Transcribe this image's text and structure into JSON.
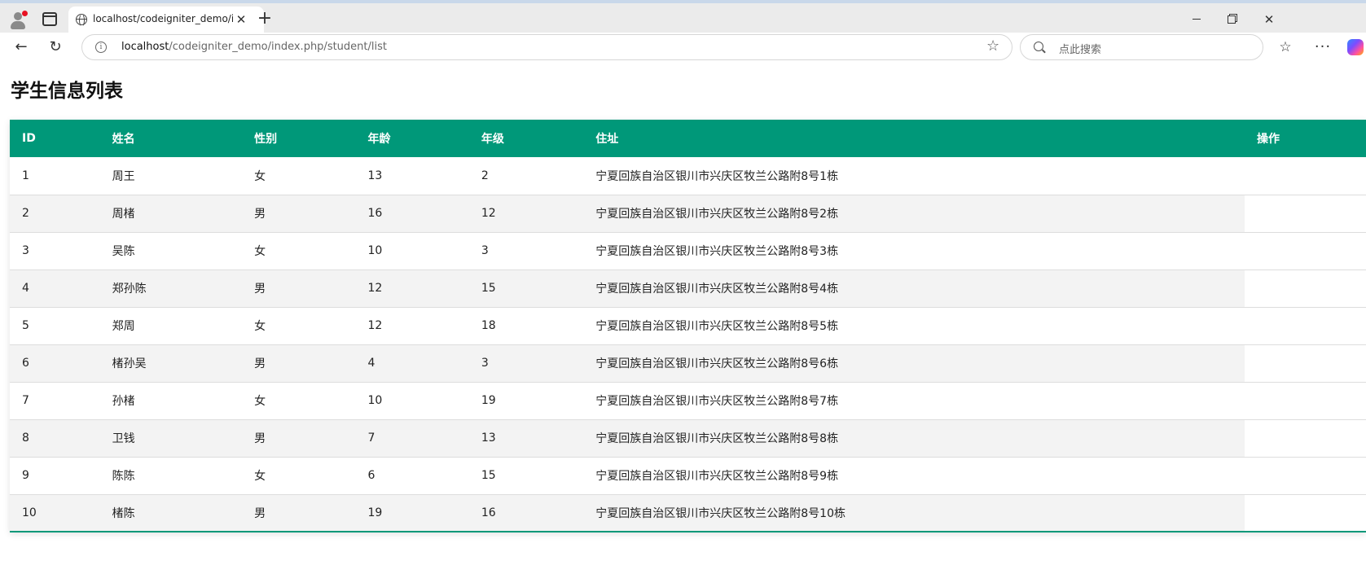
{
  "browser": {
    "tab_title": "localhost/codeigniter_demo/index.php/student/list",
    "tab_close": "✕",
    "new_tab": "+",
    "url_host": "localhost",
    "url_path": "/codeigniter_demo/index.php/student/list",
    "search_placeholder": "点此搜索",
    "window_controls": {
      "close": "✕"
    }
  },
  "page": {
    "title": "学生信息列表"
  },
  "table": {
    "columns": [
      "ID",
      "姓名",
      "性别",
      "年龄",
      "年级",
      "住址",
      "操作"
    ],
    "rows": [
      {
        "id": "1",
        "name": "周王",
        "gender": "女",
        "age": "13",
        "grade": "2",
        "address": "宁夏回族自治区银川市兴庆区牧兰公路附8号1栋",
        "ops": ""
      },
      {
        "id": "2",
        "name": "周楮",
        "gender": "男",
        "age": "16",
        "grade": "12",
        "address": "宁夏回族自治区银川市兴庆区牧兰公路附8号2栋",
        "ops": ""
      },
      {
        "id": "3",
        "name": "吴陈",
        "gender": "女",
        "age": "10",
        "grade": "3",
        "address": "宁夏回族自治区银川市兴庆区牧兰公路附8号3栋",
        "ops": ""
      },
      {
        "id": "4",
        "name": "郑孙陈",
        "gender": "男",
        "age": "12",
        "grade": "15",
        "address": "宁夏回族自治区银川市兴庆区牧兰公路附8号4栋",
        "ops": ""
      },
      {
        "id": "5",
        "name": "郑周",
        "gender": "女",
        "age": "12",
        "grade": "18",
        "address": "宁夏回族自治区银川市兴庆区牧兰公路附8号5栋",
        "ops": ""
      },
      {
        "id": "6",
        "name": "楮孙吴",
        "gender": "男",
        "age": "4",
        "grade": "3",
        "address": "宁夏回族自治区银川市兴庆区牧兰公路附8号6栋",
        "ops": ""
      },
      {
        "id": "7",
        "name": "孙楮",
        "gender": "女",
        "age": "10",
        "grade": "19",
        "address": "宁夏回族自治区银川市兴庆区牧兰公路附8号7栋",
        "ops": ""
      },
      {
        "id": "8",
        "name": "卫钱",
        "gender": "男",
        "age": "7",
        "grade": "13",
        "address": "宁夏回族自治区银川市兴庆区牧兰公路附8号8栋",
        "ops": ""
      },
      {
        "id": "9",
        "name": "陈陈",
        "gender": "女",
        "age": "6",
        "grade": "15",
        "address": "宁夏回族自治区银川市兴庆区牧兰公路附8号9栋",
        "ops": ""
      },
      {
        "id": "10",
        "name": "楮陈",
        "gender": "男",
        "age": "19",
        "grade": "16",
        "address": "宁夏回族自治区银川市兴庆区牧兰公路附8号10栋",
        "ops": ""
      }
    ]
  },
  "colors": {
    "header_bg": "#009879",
    "header_text": "#ffffff",
    "row_alt_bg": "#f3f3f3"
  }
}
